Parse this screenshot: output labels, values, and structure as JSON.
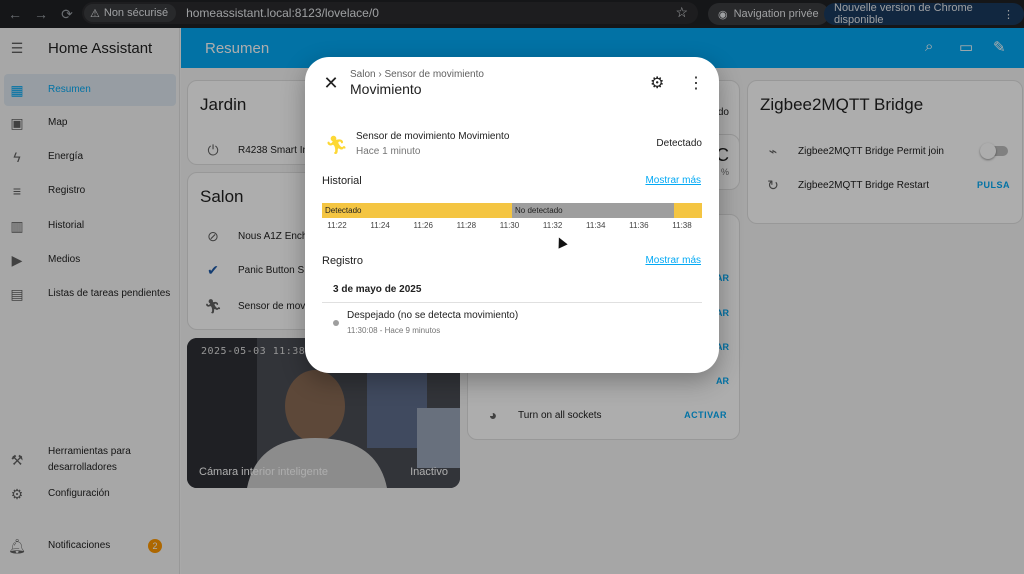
{
  "browser": {
    "insecure_label": "Non sécurisé",
    "url": "homeassistant.local:8123/lovelace/0",
    "incognito_label": "Navigation privée",
    "update_label": "Nouvelle version de Chrome disponible"
  },
  "sidebar": {
    "title": "Home Assistant",
    "items": [
      {
        "label": "Resumen",
        "icon": "dashboard-icon"
      },
      {
        "label": "Map",
        "icon": "map-icon"
      },
      {
        "label": "Energía",
        "icon": "lightning-icon"
      },
      {
        "label": "Registro",
        "icon": "list-icon"
      },
      {
        "label": "Historial",
        "icon": "chart-icon"
      },
      {
        "label": "Medios",
        "icon": "media-icon"
      },
      {
        "label": "Listas de tareas pendientes",
        "icon": "clipboard-icon"
      }
    ],
    "dev_tools": "Herramientas para desarrolladores",
    "settings": "Configuración",
    "notifications": "Notificaciones",
    "notifications_count": "2"
  },
  "topbar": {
    "title": "Resumen"
  },
  "cards": {
    "jardin": {
      "title": "Jardin",
      "row": "R4238 Smart In"
    },
    "salon": {
      "title": "Salon",
      "rows": [
        "Nous A1Z Ench",
        "Panic Button S",
        "Sensor de mov"
      ]
    },
    "zigbee": {
      "title": "Zigbee2MQTT Bridge",
      "permit": "Zigbee2MQTT Bridge Permit join",
      "restart": "Zigbee2MQTT Bridge Restart",
      "restart_action": "PULSA"
    },
    "middle": {
      "partial_top": "do",
      "partial_c": "C",
      "partial_pct": "%",
      "actions": [
        "AR",
        "AR",
        "AR",
        "AR"
      ],
      "sockets": "Turn on all sockets",
      "sockets_action": "ACTIVAR"
    },
    "camera": {
      "timestamp": "2025-05-03 11:38:45",
      "name": "Cámara interior inteligente",
      "state": "Inactivo"
    }
  },
  "dialog": {
    "breadcrumb": "Salon › Sensor de movimiento",
    "title": "Movimiento",
    "entity": {
      "name": "Sensor de movimiento Movimiento",
      "time": "Hace 1 minuto",
      "state": "Detectado"
    },
    "history_title": "Historial",
    "history_link": "Mostrar más",
    "timeline": {
      "segments": [
        {
          "label": "Detectado",
          "start": 0,
          "end": 0.5,
          "color": "#f4c542"
        },
        {
          "label": "No detectado",
          "start": 0.5,
          "end": 0.925,
          "color": "#9e9e9e"
        },
        {
          "label": "",
          "start": 0.925,
          "end": 1.0,
          "color": "#f4c542"
        }
      ],
      "ticks": [
        "11:22",
        "11:24",
        "11:26",
        "11:28",
        "11:30",
        "11:32",
        "11:34",
        "11:36",
        "11:38"
      ]
    },
    "log_title": "Registro",
    "log_link": "Mostrar más",
    "log_date": "3 de mayo de 2025",
    "log_entry": {
      "message": "Despejado (no se detecta movimiento)",
      "time": "11:30:08 - Hace 9 minutos"
    }
  },
  "colors": {
    "accent": "#03a9f4",
    "detected": "#f4c542",
    "not_detected": "#9e9e9e",
    "badge": "#ff9800"
  }
}
